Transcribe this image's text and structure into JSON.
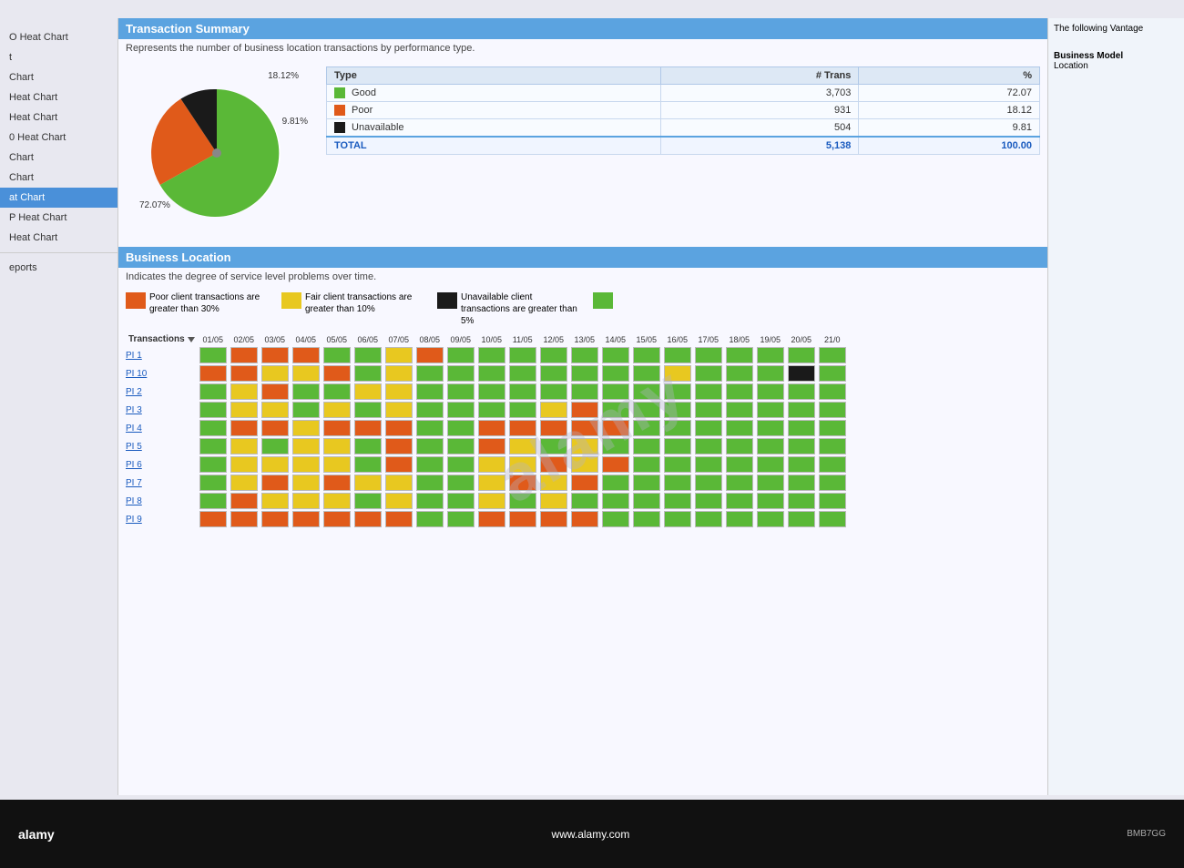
{
  "sidebar": {
    "items": [
      {
        "label": "O Heat Chart",
        "active": false
      },
      {
        "label": "t",
        "active": false
      },
      {
        "label": "Chart",
        "active": false
      },
      {
        "label": "Heat Chart",
        "active": false
      },
      {
        "label": "Heat Chart",
        "active": false
      },
      {
        "label": "0 Heat Chart",
        "active": false
      },
      {
        "label": "Chart",
        "active": false
      },
      {
        "label": "Chart",
        "active": false
      },
      {
        "label": "at Chart",
        "active": true
      },
      {
        "label": "P Heat Chart",
        "active": false
      },
      {
        "label": "Heat Chart",
        "active": false
      },
      {
        "label": "eports",
        "active": false
      }
    ]
  },
  "transaction_summary": {
    "section_title": "Transaction Summary",
    "description": "Represents the number of business location transactions by performance type.",
    "pie_labels": {
      "top": "18.12%",
      "right": "9.81%",
      "bottom": "72.07%"
    },
    "table": {
      "headers": [
        "Type",
        "# Trans",
        "%"
      ],
      "rows": [
        {
          "color": "#5ab837",
          "type": "Good",
          "trans": "3,703",
          "pct": "72.07"
        },
        {
          "color": "#e05a1a",
          "type": "Poor",
          "trans": "931",
          "pct": "18.12"
        },
        {
          "color": "#1a1a1a",
          "type": "Unavailable",
          "trans": "504",
          "pct": "9.81"
        }
      ],
      "total_label": "TOTAL",
      "total_trans": "5,138",
      "total_pct": "100.00"
    }
  },
  "business_location": {
    "section_title": "Business Location",
    "description": "Indicates the degree of service level problems over time.",
    "legend": [
      {
        "color": "#e05a1a",
        "text": "Poor client transactions are greater than 30%"
      },
      {
        "color": "#e8c820",
        "text": "Fair client transactions are greater than 10%"
      },
      {
        "color": "#1a1a1a",
        "text": "Unavailable client transactions are greater than 5%"
      },
      {
        "color": "#5ab837",
        "text": ""
      }
    ],
    "date_headers": [
      "01/05",
      "02/05",
      "03/05",
      "04/05",
      "05/05",
      "06/05",
      "07/05",
      "08/05",
      "09/05",
      "10/05",
      "11/05",
      "12/05",
      "13/05",
      "14/05",
      "15/05",
      "16/05",
      "17/05",
      "18/05",
      "19/05",
      "20/05",
      "21/0"
    ],
    "rows": [
      {
        "label": "PI 1",
        "cells": [
          "go",
          "or",
          "or",
          "or",
          "go",
          "go",
          "ya",
          "or",
          "go",
          "go",
          "go",
          "go",
          "go",
          "go",
          "go",
          "go",
          "go",
          "go",
          "go",
          "go",
          "go"
        ]
      },
      {
        "label": "PI 10",
        "cells": [
          "or",
          "or",
          "ya",
          "ya",
          "or",
          "go",
          "ya",
          "go",
          "go",
          "go",
          "go",
          "go",
          "go",
          "go",
          "go",
          "ya",
          "go",
          "go",
          "go",
          "bk",
          "go"
        ]
      },
      {
        "label": "PI 2",
        "cells": [
          "go",
          "ya",
          "or",
          "go",
          "go",
          "ya",
          "ya",
          "go",
          "go",
          "go",
          "go",
          "go",
          "go",
          "go",
          "go",
          "go",
          "go",
          "go",
          "go",
          "go",
          "go"
        ]
      },
      {
        "label": "PI 3",
        "cells": [
          "go",
          "ya",
          "ya",
          "go",
          "ya",
          "go",
          "ya",
          "go",
          "go",
          "go",
          "go",
          "ya",
          "or",
          "go",
          "go",
          "go",
          "go",
          "go",
          "go",
          "go",
          "go"
        ]
      },
      {
        "label": "PI 4",
        "cells": [
          "go",
          "or",
          "or",
          "ya",
          "or",
          "or",
          "or",
          "go",
          "go",
          "or",
          "or",
          "or",
          "or",
          "or",
          "go",
          "go",
          "go",
          "go",
          "go",
          "go",
          "go"
        ]
      },
      {
        "label": "PI 5",
        "cells": [
          "go",
          "ya",
          "go",
          "ya",
          "ya",
          "go",
          "or",
          "go",
          "go",
          "or",
          "ya",
          "go",
          "ya",
          "go",
          "go",
          "go",
          "go",
          "go",
          "go",
          "go",
          "go"
        ]
      },
      {
        "label": "PI 6",
        "cells": [
          "go",
          "ya",
          "ya",
          "ya",
          "ya",
          "go",
          "or",
          "go",
          "go",
          "ya",
          "ya",
          "or",
          "ya",
          "or",
          "go",
          "go",
          "go",
          "go",
          "go",
          "go",
          "go"
        ]
      },
      {
        "label": "PI 7",
        "cells": [
          "go",
          "ya",
          "or",
          "ya",
          "or",
          "ya",
          "ya",
          "go",
          "go",
          "ya",
          "or",
          "ya",
          "or",
          "go",
          "go",
          "go",
          "go",
          "go",
          "go",
          "go",
          "go"
        ]
      },
      {
        "label": "PI 8",
        "cells": [
          "go",
          "or",
          "ya",
          "ya",
          "ya",
          "go",
          "ya",
          "go",
          "go",
          "ya",
          "go",
          "ya",
          "go",
          "go",
          "go",
          "go",
          "go",
          "go",
          "go",
          "go",
          "go"
        ]
      },
      {
        "label": "PI 9",
        "cells": [
          "or",
          "or",
          "or",
          "or",
          "or",
          "or",
          "or",
          "go",
          "go",
          "or",
          "or",
          "or",
          "or",
          "go",
          "go",
          "go",
          "go",
          "go",
          "go",
          "go",
          "go"
        ]
      }
    ]
  },
  "right_panel": {
    "vantage_text": "The following Vantage",
    "model_label": "Business Model",
    "location_label": "Location"
  },
  "bottom_bar": {
    "logo": "alamy",
    "url": "www.alamy.com",
    "badge": "BMB7GG"
  }
}
